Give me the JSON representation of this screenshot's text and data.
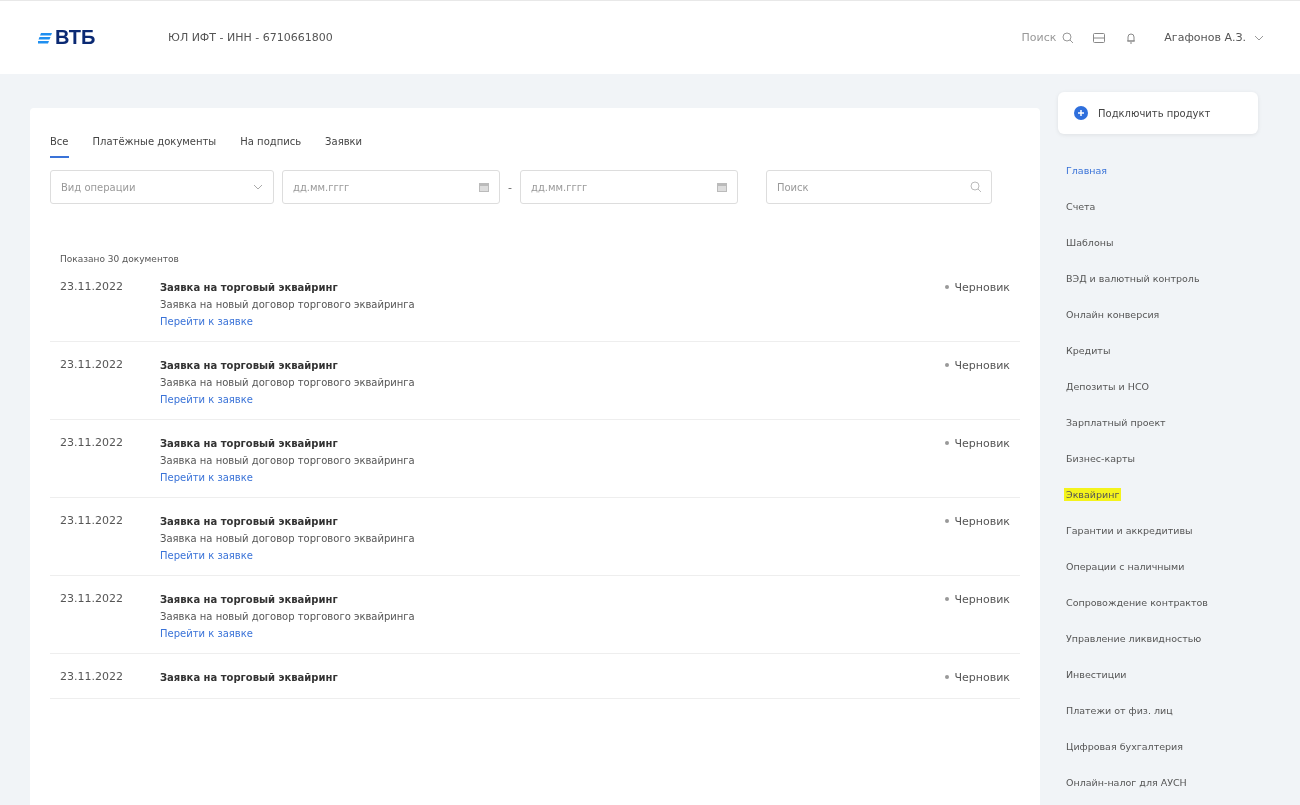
{
  "header": {
    "logo": "ВТБ",
    "company": "ЮЛ ИФТ - ИНН - 6710661800",
    "search_label": "Поиск",
    "user": "Агафонов А.З."
  },
  "tabs": [
    {
      "label": "Все",
      "selected": true
    },
    {
      "label": "Платёжные документы",
      "selected": false
    },
    {
      "label": "На подпись",
      "selected": false
    },
    {
      "label": "Заявки",
      "selected": false
    }
  ],
  "filters": {
    "operation_type": {
      "placeholder": "Вид операции"
    },
    "date_from": {
      "placeholder": "дд.мм.гггг"
    },
    "date_separator": "-",
    "date_to": {
      "placeholder": "дд.мм.гггг"
    },
    "search": {
      "placeholder": "Поиск"
    }
  },
  "summary": "Показано 30 документов",
  "documents": [
    {
      "date": "23.11.2022",
      "title": "Заявка на торговый эквайринг",
      "description": "Заявка на новый договор торгового эквайринга",
      "link": "Перейти к заявке",
      "status": "Черновик"
    },
    {
      "date": "23.11.2022",
      "title": "Заявка на торговый эквайринг",
      "description": "Заявка на новый договор торгового эквайринга",
      "link": "Перейти к заявке",
      "status": "Черновик"
    },
    {
      "date": "23.11.2022",
      "title": "Заявка на торговый эквайринг",
      "description": "Заявка на новый договор торгового эквайринга",
      "link": "Перейти к заявке",
      "status": "Черновик"
    },
    {
      "date": "23.11.2022",
      "title": "Заявка на торговый эквайринг",
      "description": "Заявка на новый договор торгового эквайринга",
      "link": "Перейти к заявке",
      "status": "Черновик"
    },
    {
      "date": "23.11.2022",
      "title": "Заявка на торговый эквайринг",
      "description": "Заявка на новый договор торгового эквайринга",
      "link": "Перейти к заявке",
      "status": "Черновик"
    },
    {
      "date": "23.11.2022",
      "title": "Заявка на торговый эквайринг",
      "status": "Черновик"
    }
  ],
  "sidebar": {
    "connect_button": "Подключить продукт",
    "items": [
      {
        "label": "Главная",
        "selected": true,
        "highlighted": false
      },
      {
        "label": "Счета",
        "selected": false,
        "highlighted": false
      },
      {
        "label": "Шаблоны",
        "selected": false,
        "highlighted": false
      },
      {
        "label": "ВЭД и валютный контроль",
        "selected": false,
        "highlighted": false
      },
      {
        "label": "Онлайн конверсия",
        "selected": false,
        "highlighted": false
      },
      {
        "label": "Кредиты",
        "selected": false,
        "highlighted": false
      },
      {
        "label": "Депозиты и НСО",
        "selected": false,
        "highlighted": false
      },
      {
        "label": "Зарплатный проект",
        "selected": false,
        "highlighted": false
      },
      {
        "label": "Бизнес-карты",
        "selected": false,
        "highlighted": false
      },
      {
        "label": "Эквайринг",
        "selected": false,
        "highlighted": true
      },
      {
        "label": "Гарантии и аккредитивы",
        "selected": false,
        "highlighted": false
      },
      {
        "label": "Операции с наличными",
        "selected": false,
        "highlighted": false
      },
      {
        "label": "Сопровождение контрактов",
        "selected": false,
        "highlighted": false
      },
      {
        "label": "Управление ликвидностью",
        "selected": false,
        "highlighted": false
      },
      {
        "label": "Инвестиции",
        "selected": false,
        "highlighted": false
      },
      {
        "label": "Платежи от физ. лиц",
        "selected": false,
        "highlighted": false
      },
      {
        "label": "Цифровая бухгалтерия",
        "selected": false,
        "highlighted": false
      },
      {
        "label": "Онлайн-налог для АУСН",
        "selected": false,
        "highlighted": false
      }
    ]
  }
}
